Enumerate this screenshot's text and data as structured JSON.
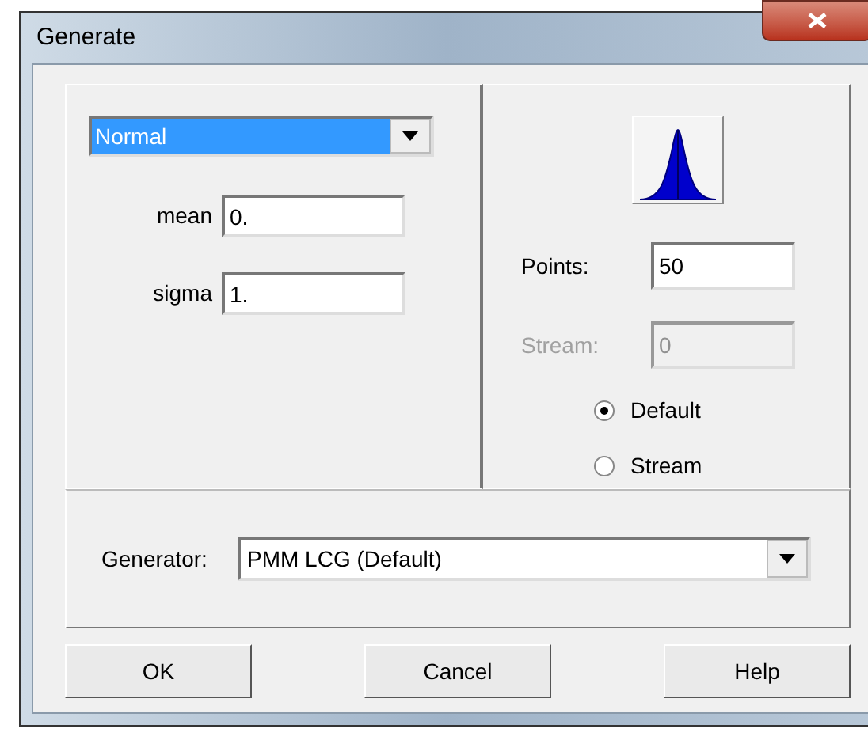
{
  "window": {
    "title": "Generate"
  },
  "distribution": {
    "value": "Normal"
  },
  "parameters": [
    {
      "label": "mean",
      "value": "0."
    },
    {
      "label": "sigma",
      "value": "1."
    }
  ],
  "points": {
    "label": "Points:",
    "value": "50"
  },
  "stream": {
    "label": "Stream:",
    "value": "0",
    "disabled": true
  },
  "seed_source": [
    {
      "label": "Default",
      "selected": true
    },
    {
      "label": "Stream",
      "selected": false
    }
  ],
  "generator": {
    "label": "Generator:",
    "value": "PMM LCG (Default)"
  },
  "buttons": [
    "OK",
    "Cancel",
    "Help"
  ]
}
